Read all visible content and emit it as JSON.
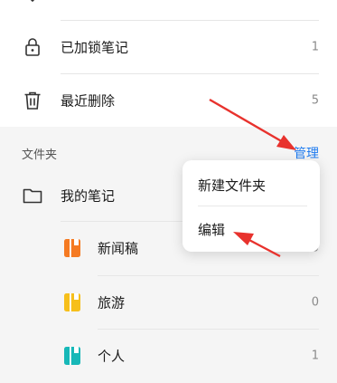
{
  "items": {
    "locked": {
      "label": "已加锁笔记",
      "count": "1",
      "icon": "lock-icon"
    },
    "recent_deleted": {
      "label": "最近删除",
      "count": "5",
      "icon": "trash-icon"
    }
  },
  "folders_section": {
    "title": "文件夹",
    "manage_label": "管理"
  },
  "folders": {
    "my_notes": {
      "label": "我的笔记",
      "icon": "folder-icon"
    },
    "news": {
      "label": "新闻稿",
      "count": "0",
      "color": "#f57a22"
    },
    "travel": {
      "label": "旅游",
      "count": "0",
      "color": "#f6bf1b"
    },
    "personal": {
      "label": "个人",
      "count": "1",
      "color": "#17b8b8"
    }
  },
  "popup_menu": {
    "new_folder": "新建文件夹",
    "edit": "编辑"
  },
  "colors": {
    "accent": "#1e7bf0",
    "annotation_arrow": "#e8322d"
  }
}
